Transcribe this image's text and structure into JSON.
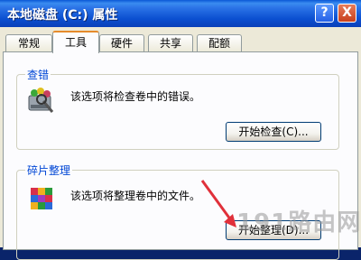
{
  "window": {
    "title": "本地磁盘 (C:) 属性",
    "help_btn": "?",
    "close_btn": "X"
  },
  "tabs": [
    {
      "label": "常规"
    },
    {
      "label": "工具",
      "active": true
    },
    {
      "label": "硬件"
    },
    {
      "label": "共享"
    },
    {
      "label": "配额"
    }
  ],
  "error_check": {
    "label": "查错",
    "desc": "该选项将检查卷中的错误。",
    "button": "开始检查(C)..."
  },
  "defrag": {
    "label": "碎片整理",
    "desc": "该选项将整理卷中的文件。",
    "button": "开始整理(D)..."
  },
  "watermark": "191路由网",
  "colors": {
    "titlebar": "#0a58d6",
    "tab_accent": "#e68b2c",
    "group_label": "#0046d5",
    "annotation_arrow": "#e0303a"
  },
  "icons": [
    "help-icon",
    "close-icon",
    "disk-check-icon",
    "defrag-icon",
    "arrow-annotation"
  ]
}
